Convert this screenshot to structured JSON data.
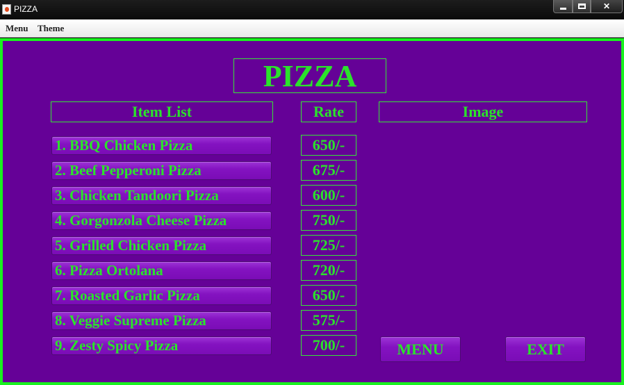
{
  "window": {
    "title": "PIZZA",
    "minimize": "minimize",
    "maximize": "maximize",
    "close": "✕"
  },
  "menubar": {
    "items": [
      "Menu",
      "Theme"
    ]
  },
  "main": {
    "heading": "PIZZA",
    "columns": {
      "items": "Item List",
      "rate": "Rate",
      "image": "Image"
    },
    "items": [
      {
        "label": "1. BBQ Chicken Pizza",
        "rate": "650/-"
      },
      {
        "label": "2. Beef Pepperoni Pizza",
        "rate": "675/-"
      },
      {
        "label": "3. Chicken Tandoori Pizza",
        "rate": "600/-"
      },
      {
        "label": "4. Gorgonzola Cheese Pizza",
        "rate": "750/-"
      },
      {
        "label": "5. Grilled Chicken Pizza",
        "rate": "725/-"
      },
      {
        "label": "6. Pizza Ortolana",
        "rate": "720/-"
      },
      {
        "label": "7. Roasted Garlic Pizza",
        "rate": "650/-"
      },
      {
        "label": "8. Veggie Supreme Pizza",
        "rate": "575/-"
      },
      {
        "label": "9. Zesty Spicy Pizza",
        "rate": "700/-"
      }
    ],
    "buttons": {
      "menu": "MENU",
      "exit": "EXIT"
    }
  },
  "colors": {
    "background": "#650197",
    "accent": "#2be32b",
    "border": "#19f11f",
    "button": "#8413c1"
  },
  "icons": {
    "app": "java-app-icon"
  }
}
